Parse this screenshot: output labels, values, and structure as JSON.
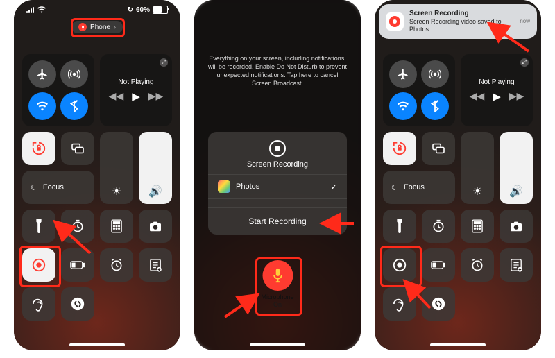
{
  "status": {
    "battery_text": "60%",
    "battery_icon_name": "battery-icon"
  },
  "phone1": {
    "pill_label": "Phone",
    "media_label": "Not Playing",
    "focus_label": "Focus"
  },
  "phone2": {
    "warning": "Everything on your screen, including notifications, will be recorded. Enable Do Not Disturb to prevent unexpected notifications. Tap here to cancel Screen Broadcast.",
    "card_title": "Screen Recording",
    "app_option": "Photos",
    "start_label": "Start Recording",
    "mic_label": "Microphone",
    "mic_state": "On"
  },
  "phone3": {
    "banner_title": "Screen Recording",
    "banner_sub": "Screen Recording video saved to Photos",
    "banner_when": "now",
    "media_label": "Not Playing",
    "focus_label": "Focus"
  },
  "annotation_color": "#ff2a1a"
}
